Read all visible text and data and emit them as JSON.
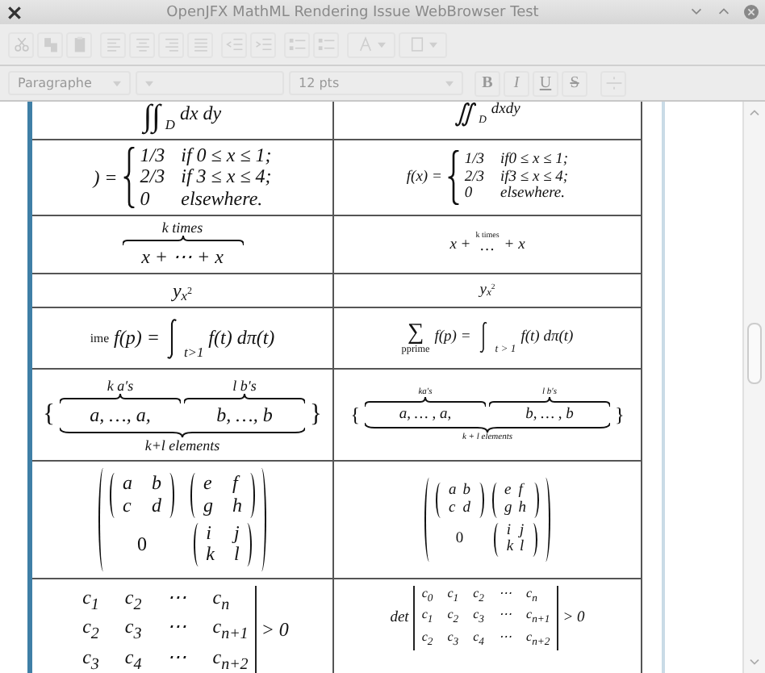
{
  "window": {
    "title": "OpenJFX MathML Rendering Issue WebBrowser Test"
  },
  "toolbar": {
    "disabled": true,
    "groups": [
      [
        {
          "kind": "cut"
        },
        {
          "kind": "copy"
        },
        {
          "kind": "paste"
        }
      ],
      [
        {
          "kind": "align-left"
        },
        {
          "kind": "align-center"
        },
        {
          "kind": "align-right"
        },
        {
          "kind": "justify"
        }
      ],
      [
        {
          "kind": "outdent"
        },
        {
          "kind": "indent"
        }
      ],
      [
        {
          "kind": "bullets"
        },
        {
          "kind": "numbering"
        }
      ],
      [
        {
          "kind": "text-color"
        },
        {
          "kind": "highlight"
        }
      ]
    ]
  },
  "format_bar": {
    "disabled": true,
    "paragraph_style": "Paragraphe",
    "font_size": "12 pts",
    "buttons": [
      {
        "kind": "bold",
        "label": "B"
      },
      {
        "kind": "italic",
        "label": "I"
      },
      {
        "kind": "underline",
        "label": "U"
      },
      {
        "kind": "strikethrough",
        "label": "S"
      },
      {
        "kind": "rule"
      }
    ]
  },
  "table": {
    "rows": [
      {
        "left": {
          "kind": "double_integral",
          "sign": "∫∫",
          "sub": "D",
          "body": "dx dy"
        },
        "right": {
          "kind": "double_integral",
          "sign": "∬",
          "sub": "D",
          "body": "dxdy"
        }
      },
      {
        "left": {
          "kind": "cases",
          "lhs": ") =",
          "cases": [
            [
              "1/3",
              "if 0 ≤ x ≤ 1;"
            ],
            [
              "2/3",
              "if 3 ≤ x ≤ 4;"
            ],
            [
              "0",
              "elsewhere."
            ]
          ]
        },
        "right": {
          "kind": "cases",
          "lhs": "f(x) =",
          "cases": [
            [
              "1/3",
              "if0 ≤ x ≤ 1;"
            ],
            [
              "2/3",
              "if3 ≤ x ≤ 4;"
            ],
            [
              "0",
              "elsewhere."
            ]
          ]
        }
      },
      {
        "left": {
          "kind": "overbrace",
          "label": "k times",
          "body": "x + ⋯ + x"
        },
        "right": {
          "kind": "overset",
          "before": "x +",
          "over": "k times",
          "base": "…",
          "after": "+ x"
        }
      },
      {
        "left": {
          "kind": "subsup",
          "base": "y",
          "sub": "x",
          "sup": "2"
        },
        "right": {
          "kind": "subsup",
          "base": "y",
          "sub": "x",
          "sup": "2"
        }
      },
      {
        "left": {
          "kind": "sum_integral",
          "sum_sub": "ime",
          "lhs": "f(p) =",
          "int_sub": "t>1",
          "body": "f(t) dπ(t)"
        },
        "right": {
          "kind": "sum_integral",
          "sum": "∑",
          "sum_sub": "pprime",
          "lhs": "f(p) =",
          "int_sub": "t > 1",
          "body": "f(t) dπ(t)"
        }
      },
      {
        "left": {
          "kind": "braces",
          "open": "{",
          "close": "}",
          "groups": [
            {
              "over": "k a′s",
              "body": "a, …, a,"
            },
            {
              "over": "l b′s",
              "body": "b, …, b"
            }
          ],
          "under": "k+l elements"
        },
        "right": {
          "kind": "braces",
          "open": "{",
          "close": "}",
          "groups": [
            {
              "over": "ka′s",
              "body": "a, … , a,"
            },
            {
              "over": "l b′s",
              "body": "b, … , b"
            }
          ],
          "under": "k + l elements"
        }
      },
      {
        "left": {
          "kind": "block_matrix",
          "rows": [
            [
              [
                [
                  "a",
                  "b"
                ],
                [
                  "c",
                  "d"
                ]
              ],
              [
                [
                  "e",
                  "f"
                ],
                [
                  "g",
                  "h"
                ]
              ]
            ],
            [
              "0",
              [
                [
                  "i",
                  "j"
                ],
                [
                  "k",
                  "l"
                ]
              ]
            ]
          ]
        },
        "right": {
          "kind": "block_matrix",
          "rows": [
            [
              [
                [
                  "a",
                  "b"
                ],
                [
                  "c",
                  "d"
                ]
              ],
              [
                [
                  "e",
                  "f"
                ],
                [
                  "g",
                  "h"
                ]
              ]
            ],
            [
              "0",
              [
                [
                  "i",
                  "j"
                ],
                [
                  "k",
                  "l"
                ]
              ]
            ]
          ]
        }
      },
      {
        "left": {
          "kind": "determinant",
          "rows": [
            [
              "c$_{1}$",
              "c$_{2}$",
              "⋯",
              "c$_{n}$"
            ],
            [
              "c$_{2}$",
              "c$_{3}$",
              "⋯",
              "c$_{n+1}$"
            ],
            [
              "c$_{3}$",
              "c$_{4}$",
              "⋯",
              "c$_{n+2}$"
            ]
          ],
          "rhs": "> 0"
        },
        "right": {
          "kind": "determinant",
          "prefix": "det",
          "rows": [
            [
              "c$_{0}$",
              "c$_{1}$",
              "c$_{2}$",
              "⋯",
              "c$_{n}$"
            ],
            [
              "c$_{1}$",
              "c$_{2}$",
              "c$_{3}$",
              "⋯",
              "c$_{n+1}$"
            ],
            [
              "c$_{2}$",
              "c$_{3}$",
              "c$_{4}$",
              "⋯",
              "c$_{n+2}$"
            ]
          ],
          "rhs": "> 0"
        }
      }
    ]
  }
}
